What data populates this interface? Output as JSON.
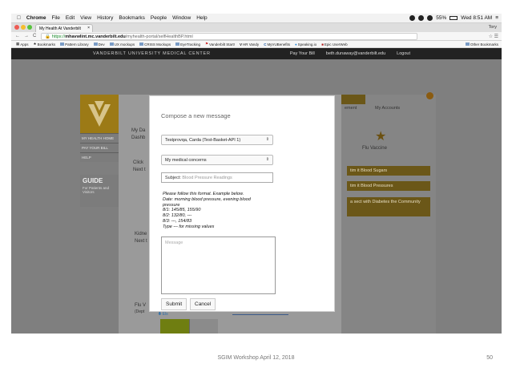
{
  "menubar": {
    "app": "Chrome",
    "items": [
      "File",
      "Edit",
      "View",
      "History",
      "Bookmarks",
      "People",
      "Window",
      "Help"
    ],
    "battery": "55%",
    "clock": "Wed 8:51 AM"
  },
  "tabs": {
    "active_title": "My Health At Vanderbilt",
    "profile": "Tory"
  },
  "address": {
    "scheme": "https://",
    "domain": "mhavwlint.mc.vanderbilt.edu",
    "path": "/myhealth-portal/selfHealthBP.html"
  },
  "bookmarks": {
    "items": [
      "Apps",
      "Bookmarks",
      "Pattern Library",
      "Dev",
      "UX mockups",
      "CRISS Mockups",
      "EyeTracking",
      "Vanderbilt Start!",
      "HR Vandy",
      "MyVUBenefits",
      "Speaking.io",
      "Epic UserWeb"
    ],
    "other": "Other Bookmarks"
  },
  "site_header": {
    "brand": "VANDERBILT UNIVERSITY MEDICAL CENTER",
    "pay_bill": "Pay Your Bill",
    "email": "beth.dunaway@vanderbilt.edu",
    "logout": "Logout"
  },
  "left_nav": {
    "items": [
      "MY HEALTH HOME",
      "PAY YOUR BILL",
      "HELP"
    ],
    "guide_title": "GUIDE",
    "guide_sub": "For Patients and Visitors"
  },
  "background_text": {
    "my_da": "My Da",
    "dash": "Dashb",
    "click": "Click",
    "next1": "Next t",
    "kidney": "Kidne",
    "next2": "Next t",
    "flu": "Flu V",
    "dept": "(Dept",
    "mgmt": "ement",
    "my_accounts": "My Accounts",
    "flu_vaccine": "Flu Vaccine",
    "gold1": "tim it Blood Sugars",
    "gold2": "tim it Blood Pressures",
    "gold3": "a sect with Diabetes the Community",
    "arrow_label": "Els"
  },
  "modal": {
    "title": "Compose a new message",
    "recipient": "Testprovqa, Carda (Test-Basket-API 1)",
    "topic": "My medical concerns",
    "subject_label": "Subject:",
    "subject_value": "Blood Pressure Readings",
    "instructions": [
      "Please follow this format. Example below.",
      "Date: morning blood pressure, evening blood",
      "pressure",
      "8/1: 145/85, 155/90",
      "8/2: 132/80, ---",
      "8/3: ---, 154/83",
      "Type --- for missing values"
    ],
    "message_placeholder": "Message",
    "submit": "Submit",
    "cancel": "Cancel"
  },
  "footer": {
    "text": "SGIM Workshop April 12, 2018",
    "slide_number": "50"
  }
}
